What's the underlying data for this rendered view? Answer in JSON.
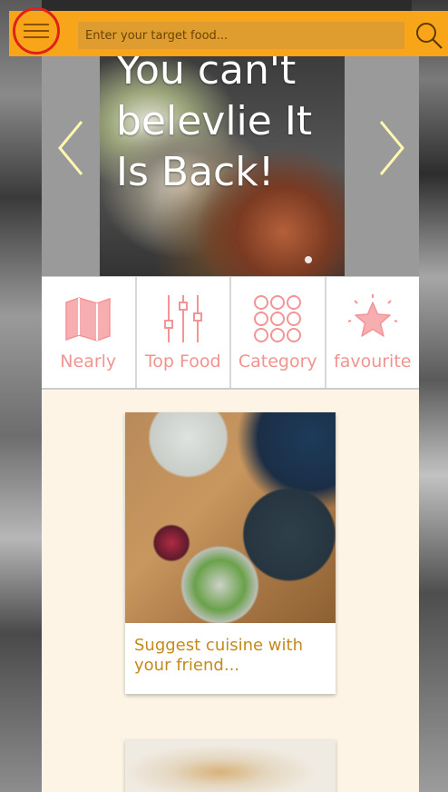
{
  "header": {
    "search_placeholder": "Enter your target food..."
  },
  "carousel": {
    "slide_title": "You can't belevlie It Is Back!",
    "active_index": 0,
    "slide_count": 1
  },
  "quicknav": {
    "items": [
      {
        "label": "Nearly",
        "icon": "map-icon"
      },
      {
        "label": "Top Food",
        "icon": "sliders-icon"
      },
      {
        "label": "Category",
        "icon": "grid-dots-icon"
      },
      {
        "label": "favourite",
        "icon": "star-icon"
      }
    ]
  },
  "cards": [
    {
      "caption": "Suggest cuisine with your friend..."
    },
    {
      "caption": ""
    }
  ],
  "colors": {
    "header": "#f9a51a",
    "menu_ring": "#e0201b",
    "nav_label": "#f1948f",
    "caption": "#c48a1a",
    "content_bg": "#fdf4e5"
  }
}
